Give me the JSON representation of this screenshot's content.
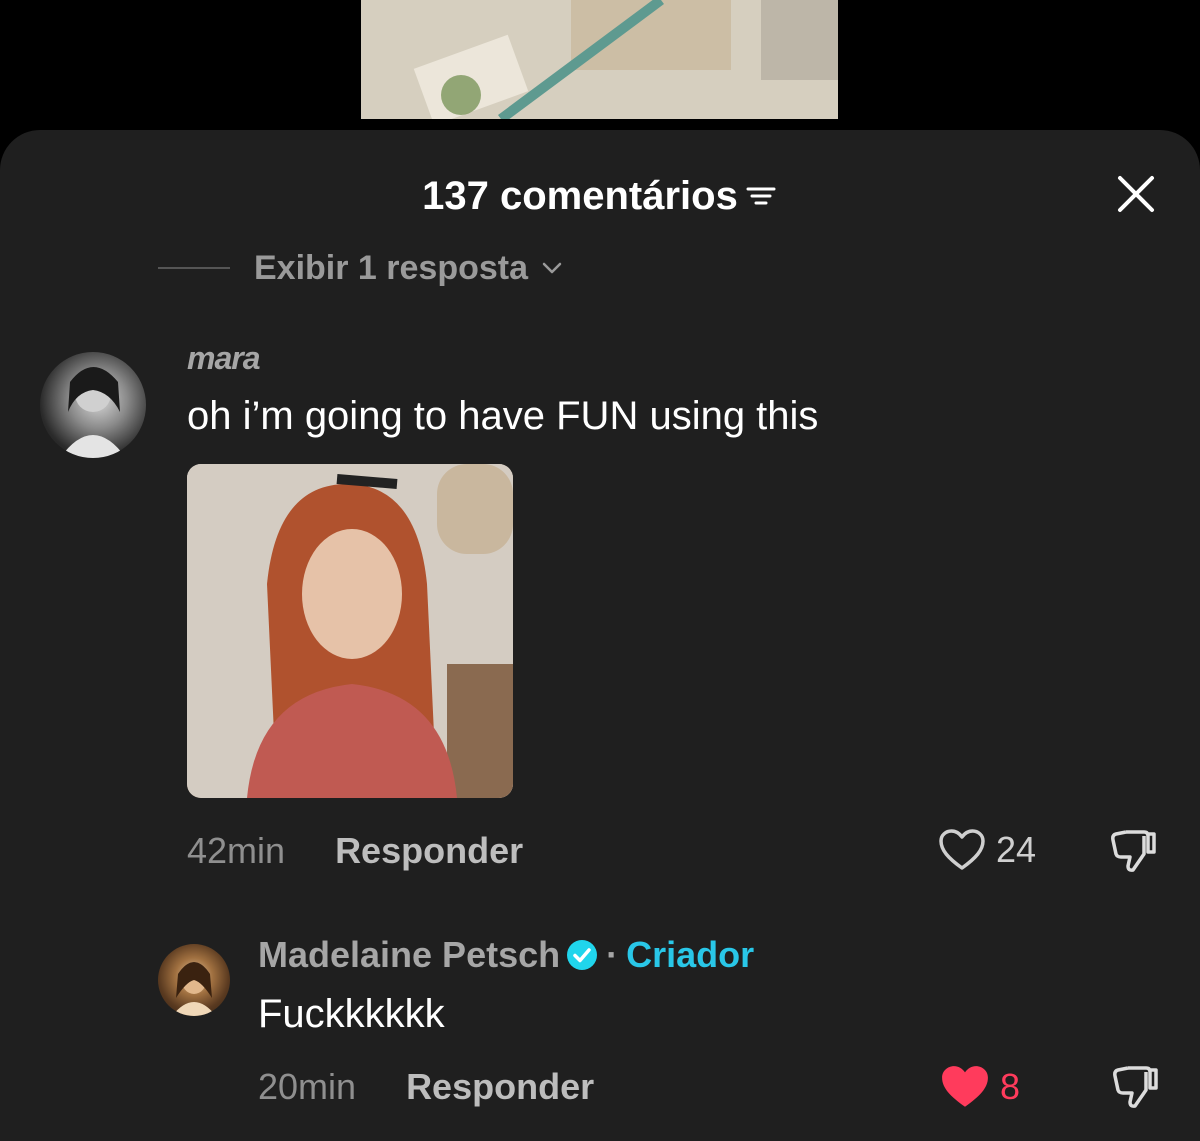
{
  "header": {
    "title": "137 comentários",
    "filter_icon": "filter-icon",
    "close_icon": "close-icon"
  },
  "view_replies": {
    "label": "Exibir 1 resposta",
    "icon": "chevron-down-icon"
  },
  "comments": [
    {
      "username": "mara",
      "text": "oh i’m going to have FUN using this",
      "has_sticker": true,
      "time": "42min",
      "reply_label": "Responder",
      "likes": "24",
      "liked": false
    }
  ],
  "reply": {
    "username": "Madelaine Petsch",
    "verified": true,
    "separator": "·",
    "creator_label": "Criador",
    "text": "Fuckkkkkk",
    "time": "20min",
    "reply_label": "Responder",
    "likes": "8",
    "liked": true
  },
  "colors": {
    "sheet_bg": "#1f1f1f",
    "creator_accent": "#29c7e8",
    "liked_heart": "#ff3b5c",
    "verified_badge": "#20d5ec"
  }
}
